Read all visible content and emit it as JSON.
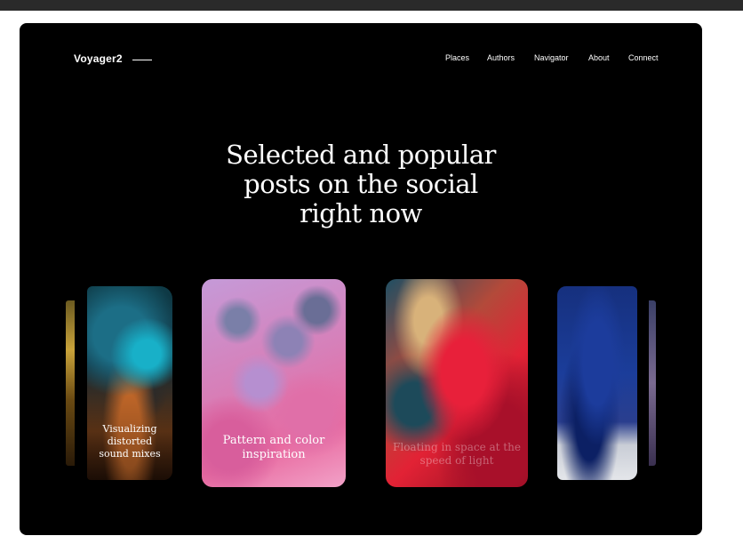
{
  "header": {
    "logo": "Voyager2"
  },
  "nav": {
    "items": [
      "Places",
      "Authors",
      "Navigator",
      "About",
      "Connect"
    ]
  },
  "hero": {
    "line1": "Selected and popular",
    "line2": "posts on the social",
    "line3": "right now"
  },
  "cards": [
    {
      "caption_l1": "Visualizing distorted",
      "caption_l2": "sound mixes"
    },
    {
      "caption_l1": "Pattern and color",
      "caption_l2": "inspiration"
    },
    {
      "caption_l1": "Floating in space at the",
      "caption_l2": "speed of light"
    },
    {
      "caption_l1": "",
      "caption_l2": ""
    }
  ]
}
